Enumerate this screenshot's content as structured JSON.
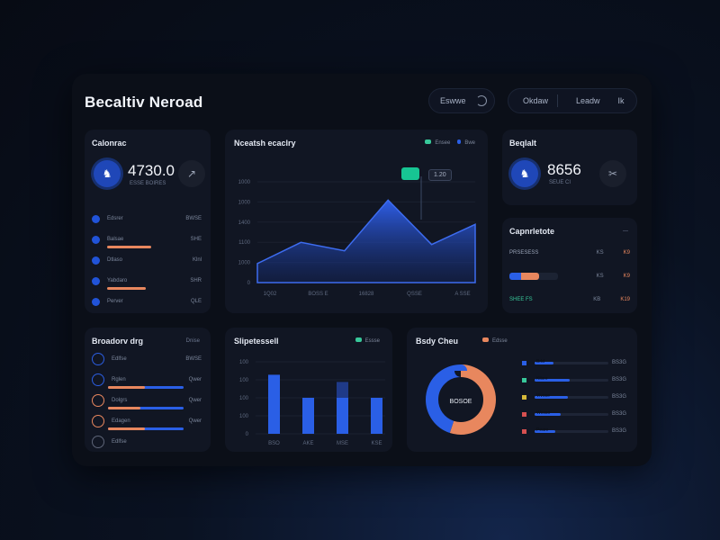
{
  "header": {
    "title": "Becaltiv Neroad",
    "btn1": "Eswwe",
    "btn2a": "Okdaw",
    "btn2b": "Leadw",
    "btn2c": "Ik"
  },
  "colors": {
    "accent": "#2a5fe6",
    "orange": "#e8875e",
    "teal": "#38c89a",
    "panel": "#111623"
  },
  "card1": {
    "title": "Calonrac",
    "value": "4730.0",
    "sub": "ESSE BOIRES",
    "rows": [
      {
        "label": "Edsrer",
        "value": "BWSE"
      },
      {
        "label": "Balsae",
        "value": "SHE",
        "bar": 0.7
      },
      {
        "label": "Dtlaso",
        "value": "Klnl"
      },
      {
        "label": "Yabdaro",
        "value": "SHR",
        "bar": 0.62
      },
      {
        "label": "Perver",
        "value": "QLE"
      }
    ]
  },
  "card2": {
    "title": "Nceatsh ecaclry",
    "legend": [
      "Ensee",
      "Bwe"
    ],
    "tag1": "",
    "tag2": "1.20"
  },
  "card3": {
    "title": "Beqlalt",
    "value": "8656",
    "sub": "SEUE CI"
  },
  "card4": {
    "title": "Capnrletote",
    "rows": [
      {
        "label": "PRSESESS",
        "a": "KS",
        "b": "K9"
      },
      {
        "label": "",
        "a": "KS",
        "b": "K9",
        "bar": 0.62
      },
      {
        "label": "SHEE FS",
        "a": "KB",
        "b": "K19"
      }
    ]
  },
  "card5": {
    "title": "Broadorv drg",
    "right": "Dnise",
    "rows": [
      {
        "label": "Edlfse",
        "value": "BWSE"
      },
      {
        "label": "Rglen",
        "value": "Qwer",
        "bar": 0.7
      },
      {
        "label": "Dolgrs",
        "value": "Qwer",
        "bar": 0.62
      },
      {
        "label": "Edagen",
        "value": "Qwer",
        "bar": 0.7
      },
      {
        "label": "Edlfse",
        "value": ""
      }
    ]
  },
  "card6": {
    "title": "Slipetessell",
    "legend": "Essse"
  },
  "card7": {
    "title": "Bsdy Cheu",
    "legend": "Edsse",
    "donut_label": "BOSOE",
    "items": [
      {
        "label": "Brld",
        "value": "BS3G",
        "color": "#2a5fe6",
        "bar": 0.25
      },
      {
        "label": "Kilsre",
        "value": "BS3G",
        "color": "#38c89a",
        "bar": 0.48
      },
      {
        "label": "Vivose",
        "value": "BS3G",
        "color": "#d6b93a",
        "bar": 0.45
      },
      {
        "label": "Wesso",
        "value": "BS3G",
        "color": "#d65050",
        "bar": 0.35
      },
      {
        "label": "Peare",
        "value": "BS3G",
        "color": "#d65050",
        "bar": 0.28
      }
    ]
  },
  "chart_data": [
    {
      "type": "area",
      "x": [
        "1Q02",
        "BOSS E",
        "16828",
        "QSSE",
        "A SSE"
      ],
      "y_ticks": [
        "0",
        "1000",
        "1100",
        "1400",
        "1000",
        "1000"
      ],
      "series": [
        {
          "values": [
            0.18,
            0.38,
            0.3,
            0.78,
            0.36,
            0.55
          ]
        }
      ]
    },
    {
      "type": "bar",
      "categories": [
        "BSO",
        "AKE",
        "MSE",
        "KSE"
      ],
      "y_ticks": [
        "100",
        "100",
        "100",
        "100",
        "0"
      ],
      "values": [
        0.82,
        0.5,
        0.5,
        0.5
      ],
      "ghost": [
        0,
        0,
        0.72,
        0
      ]
    },
    {
      "type": "pie",
      "slices": [
        {
          "value": 55,
          "color": "#e8875e"
        },
        {
          "value": 45,
          "color": "#2a5fe6"
        }
      ]
    }
  ]
}
